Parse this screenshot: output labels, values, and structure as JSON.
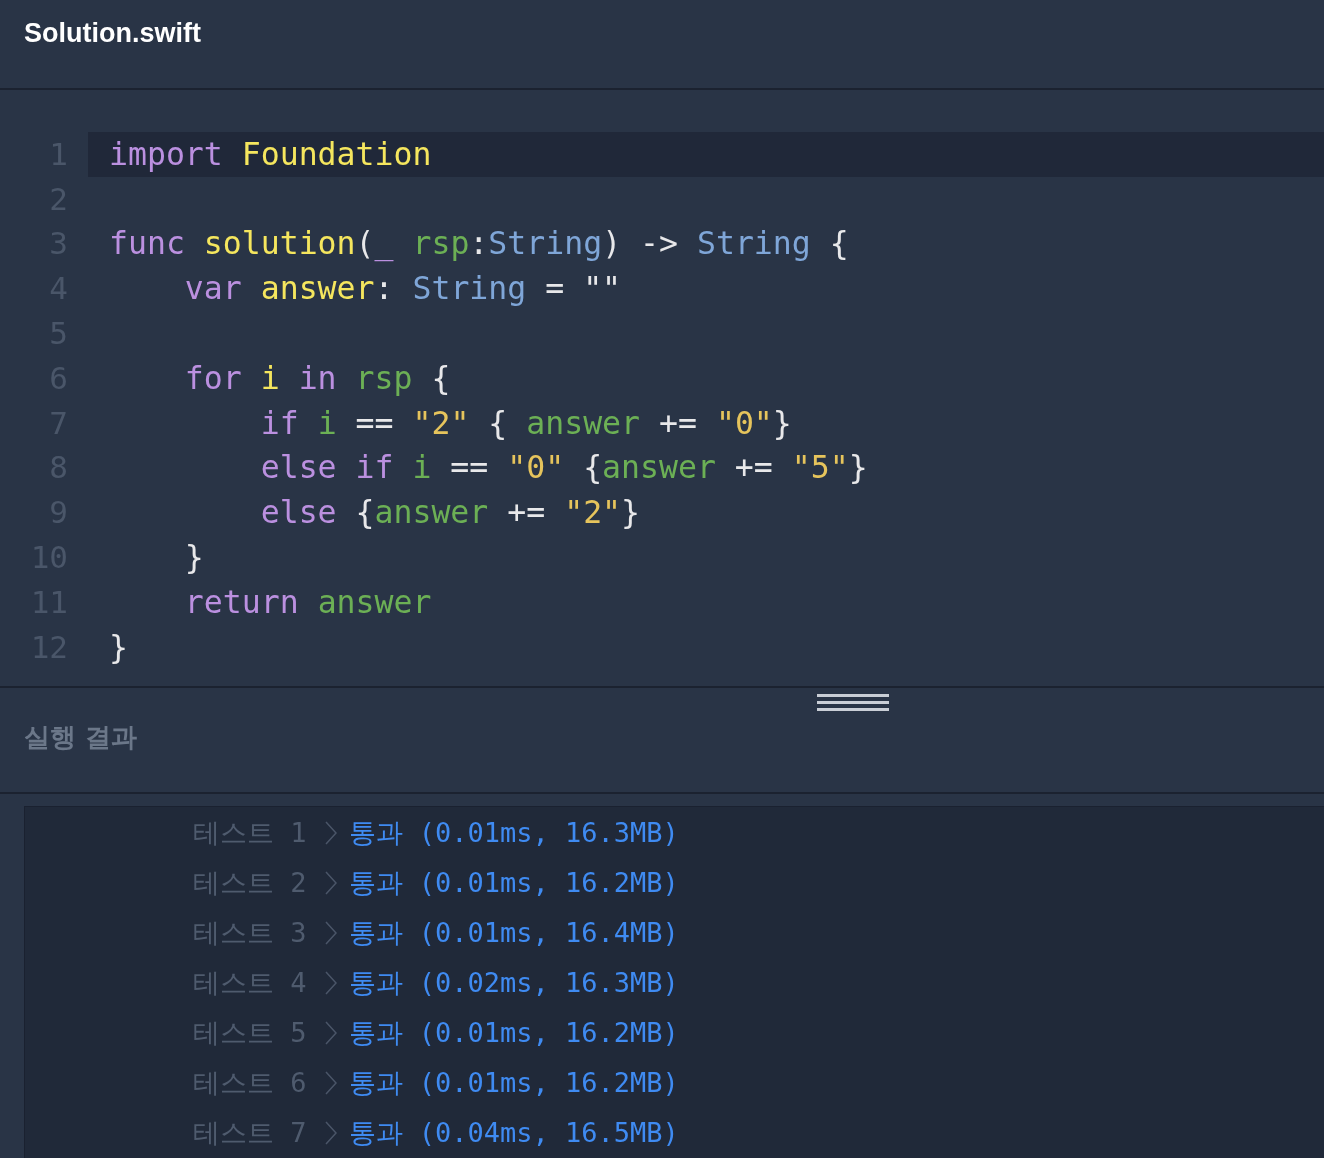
{
  "file_tab": {
    "title": "Solution.swift"
  },
  "editor": {
    "lines": [
      {
        "number": "1",
        "active": true,
        "tokens": [
          {
            "text": "import ",
            "kind": "keyword"
          },
          {
            "text": "Foundation",
            "kind": "name"
          }
        ]
      },
      {
        "number": "2",
        "active": false
      },
      {
        "number": "3",
        "active": false,
        "tokens": [
          {
            "text": "func ",
            "kind": "keyword"
          },
          {
            "text": "solution",
            "kind": "name"
          },
          {
            "text": "(",
            "kind": "plain"
          },
          {
            "text": "_ ",
            "kind": "keyword"
          },
          {
            "text": "rsp",
            "kind": "variable"
          },
          {
            "text": ":",
            "kind": "plain"
          },
          {
            "text": "String",
            "kind": "type"
          },
          {
            "text": ") -> ",
            "kind": "plain"
          },
          {
            "text": "String",
            "kind": "type"
          },
          {
            "text": " {",
            "kind": "plain"
          }
        ]
      },
      {
        "number": "4",
        "active": false,
        "tokens": [
          {
            "text": "    var ",
            "kind": "keyword"
          },
          {
            "text": "answer",
            "kind": "name"
          },
          {
            "text": ": ",
            "kind": "plain"
          },
          {
            "text": "String",
            "kind": "type"
          },
          {
            "text": " = \"\"",
            "kind": "plain"
          }
        ]
      },
      {
        "number": "5",
        "active": false
      },
      {
        "number": "6",
        "active": false,
        "tokens": [
          {
            "text": "    for ",
            "kind": "keyword"
          },
          {
            "text": "i ",
            "kind": "name"
          },
          {
            "text": "in ",
            "kind": "keyword"
          },
          {
            "text": "rsp",
            "kind": "variable"
          },
          {
            "text": " {",
            "kind": "plain"
          }
        ]
      },
      {
        "number": "7",
        "active": false,
        "tokens": [
          {
            "text": "        if ",
            "kind": "keyword"
          },
          {
            "text": "i",
            "kind": "variable"
          },
          {
            "text": " == ",
            "kind": "plain"
          },
          {
            "text": "\"2\"",
            "kind": "string"
          },
          {
            "text": " { ",
            "kind": "plain"
          },
          {
            "text": "answer",
            "kind": "variable"
          },
          {
            "text": " += ",
            "kind": "plain"
          },
          {
            "text": "\"0\"",
            "kind": "string"
          },
          {
            "text": "}",
            "kind": "plain"
          }
        ]
      },
      {
        "number": "8",
        "active": false,
        "tokens": [
          {
            "text": "        else if ",
            "kind": "keyword"
          },
          {
            "text": "i",
            "kind": "variable"
          },
          {
            "text": " == ",
            "kind": "plain"
          },
          {
            "text": "\"0\"",
            "kind": "string"
          },
          {
            "text": " {",
            "kind": "plain"
          },
          {
            "text": "answer",
            "kind": "variable"
          },
          {
            "text": " += ",
            "kind": "plain"
          },
          {
            "text": "\"5\"",
            "kind": "string"
          },
          {
            "text": "}",
            "kind": "plain"
          }
        ]
      },
      {
        "number": "9",
        "active": false,
        "tokens": [
          {
            "text": "        else ",
            "kind": "keyword"
          },
          {
            "text": "{",
            "kind": "plain"
          },
          {
            "text": "answer",
            "kind": "variable"
          },
          {
            "text": " += ",
            "kind": "plain"
          },
          {
            "text": "\"2\"",
            "kind": "string"
          },
          {
            "text": "}",
            "kind": "plain"
          }
        ]
      },
      {
        "number": "10",
        "active": false,
        "tokens": [
          {
            "text": "    }",
            "kind": "plain"
          }
        ]
      },
      {
        "number": "11",
        "active": false,
        "tokens": [
          {
            "text": "    return ",
            "kind": "keyword"
          },
          {
            "text": "answer",
            "kind": "variable"
          }
        ]
      },
      {
        "number": "12",
        "active": false,
        "tokens": [
          {
            "text": "}",
            "kind": "plain"
          }
        ]
      }
    ]
  },
  "results": {
    "title": "실행 결과",
    "rows": [
      {
        "label": "테스트 1",
        "passed": true,
        "result": "통과 (0.01ms, 16.3MB)"
      },
      {
        "label": "테스트 2",
        "passed": true,
        "result": "통과 (0.01ms, 16.2MB)"
      },
      {
        "label": "테스트 3",
        "passed": true,
        "result": "통과 (0.01ms, 16.4MB)"
      },
      {
        "label": "테스트 4",
        "passed": true,
        "result": "통과 (0.02ms, 16.3MB)"
      },
      {
        "label": "테스트 5",
        "passed": true,
        "result": "통과 (0.01ms, 16.2MB)"
      },
      {
        "label": "테스트 6",
        "passed": true,
        "result": "통과 (0.01ms, 16.2MB)"
      },
      {
        "label": "테스트 7",
        "passed": true,
        "result": "통과 (0.04ms, 16.5MB)"
      }
    ]
  }
}
